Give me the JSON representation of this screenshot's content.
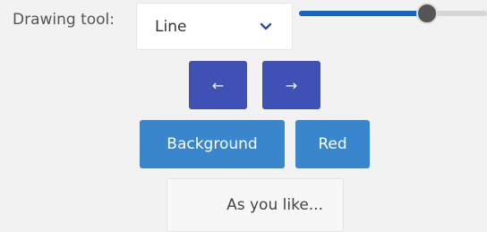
{
  "drawing_tool": {
    "label": "Drawing tool:",
    "selected": "Line"
  },
  "slider": {
    "value_fraction": 0.68
  },
  "nav": {
    "prev_label": "←",
    "next_label": "→"
  },
  "buttons": {
    "background_label": "Background",
    "color_label": "Red",
    "custom_label": "As you like..."
  },
  "icons": {
    "dropdown": "chevron-down-icon"
  },
  "colors": {
    "arrow_button": "#3f51b5",
    "action_button": "#3a86cd",
    "slider_fill": "#1565c0",
    "chevron": "#2c4f8f"
  }
}
